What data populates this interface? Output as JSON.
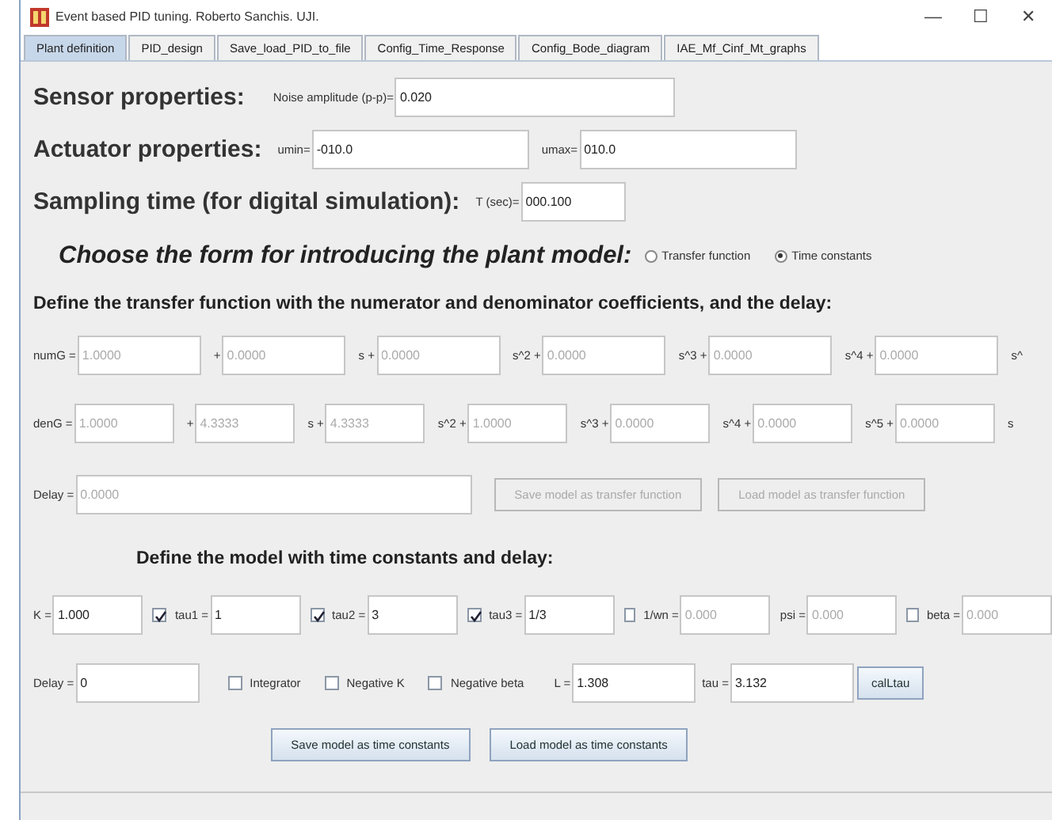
{
  "window": {
    "title": "Event based PID tuning. Roberto Sanchis. UJI.",
    "controls": [
      "—",
      "☐",
      "✕"
    ]
  },
  "tabs": [
    {
      "label": "Plant definition",
      "selected": true
    },
    {
      "label": "PID_design",
      "selected": false
    },
    {
      "label": "Save_load_PID_to_file",
      "selected": false
    },
    {
      "label": "Config_Time_Response",
      "selected": false
    },
    {
      "label": "Config_Bode_diagram",
      "selected": false
    },
    {
      "label": "IAE_Mf_Cinf_Mt_graphs",
      "selected": false
    }
  ],
  "sensor": {
    "heading": "Sensor properties:",
    "fields": [
      {
        "kind": "field",
        "label": "Noise amplitude (p-p)=",
        "value": "0.020",
        "disabled": false
      }
    ]
  },
  "actuator": {
    "heading": "Actuator properties:",
    "fields": [
      {
        "kind": "field",
        "label": "umin=",
        "value": "-010.0",
        "disabled": false
      },
      {
        "kind": "field",
        "label": "umax=",
        "value": "010.0",
        "disabled": false
      }
    ]
  },
  "sampling": {
    "heading": "Sampling time (for digital simulation):",
    "fields": [
      {
        "kind": "field",
        "label": "T (sec)=",
        "value": "000.100",
        "disabled": false
      }
    ]
  },
  "model_form": {
    "heading": "Choose the form for introducing the plant model:",
    "options": [
      {
        "label": "Transfer function",
        "selected": false
      },
      {
        "label": "Time constants",
        "selected": true
      }
    ]
  },
  "tf_heading": "Define the transfer function with the numerator and denominator coefficients, and the delay:",
  "numerator": {
    "fields": [
      {
        "kind": "field",
        "label": "numG =",
        "value": "1.0000",
        "disabled": true
      },
      {
        "kind": "field",
        "label": "+",
        "value": "0.0000",
        "disabled": true
      },
      {
        "kind": "field",
        "label": "s +",
        "value": "0.0000",
        "disabled": true
      },
      {
        "kind": "field",
        "label": "s^2 +",
        "value": "0.0000",
        "disabled": true
      },
      {
        "kind": "field",
        "label": "s^3 +",
        "value": "0.0000",
        "disabled": true
      },
      {
        "kind": "field",
        "label": "s^4 +",
        "value": "0.0000",
        "disabled": true
      },
      {
        "kind": "label",
        "label": "s^"
      }
    ]
  },
  "denominator": {
    "fields": [
      {
        "kind": "field",
        "label": "denG =",
        "value": "1.0000",
        "disabled": true
      },
      {
        "kind": "field",
        "label": "+",
        "value": "4.3333",
        "disabled": true
      },
      {
        "kind": "field",
        "label": "s +",
        "value": "4.3333",
        "disabled": true
      },
      {
        "kind": "field",
        "label": "s^2 +",
        "value": "1.0000",
        "disabled": true
      },
      {
        "kind": "field",
        "label": "s^3 +",
        "value": "0.0000",
        "disabled": true
      },
      {
        "kind": "field",
        "label": "s^4 +",
        "value": "0.0000",
        "disabled": true
      },
      {
        "kind": "field",
        "label": "s^5 +",
        "value": "0.0000",
        "disabled": true
      },
      {
        "kind": "label",
        "label": "s"
      }
    ]
  },
  "tf_delay": {
    "label": "Delay =",
    "value": "0.0000",
    "disabled": true
  },
  "tf_buttons": [
    {
      "label": "Save model as transfer function",
      "disabled": true
    },
    {
      "label": "Load model as transfer function",
      "disabled": true
    }
  ],
  "tc_heading": "Define the model with time constants and delay:",
  "tc_row": {
    "fields": [
      {
        "kind": "field",
        "label": "K =",
        "value": "1.000",
        "disabled": false
      },
      {
        "kind": "check",
        "label": "tau1 =",
        "value": "1",
        "checked": true,
        "disabled": false
      },
      {
        "kind": "check",
        "label": "tau2 =",
        "value": "3",
        "checked": true,
        "disabled": false
      },
      {
        "kind": "check",
        "label": "tau3 =",
        "value": "1/3",
        "checked": true,
        "disabled": false
      },
      {
        "kind": "check",
        "label": "1/wn =",
        "value": "0.000",
        "checked": false,
        "disabled": true
      },
      {
        "kind": "field",
        "label": "psi =",
        "value": "0.000",
        "disabled": true
      },
      {
        "kind": "check",
        "label": "beta =",
        "value": "0.000",
        "checked": false,
        "disabled": true
      }
    ]
  },
  "tc_row2": {
    "fields": [
      {
        "kind": "field",
        "label": "Delay =",
        "value": "0",
        "disabled": false
      },
      {
        "kind": "checkonly",
        "label": "Integrator",
        "checked": false
      },
      {
        "kind": "checkonly",
        "label": "Negative K",
        "checked": false
      },
      {
        "kind": "checkonly",
        "label": "Negative beta",
        "checked": false
      },
      {
        "kind": "field",
        "label": "L =",
        "value": "1.308",
        "disabled": false
      },
      {
        "kind": "field",
        "label": "tau =",
        "value": "3.132",
        "disabled": false
      },
      {
        "kind": "button",
        "label": "calLtau",
        "disabled": false
      }
    ]
  },
  "tc_buttons": [
    {
      "label": "Save model as time constants",
      "disabled": false
    },
    {
      "label": "Load model as time constants",
      "disabled": false
    }
  ]
}
